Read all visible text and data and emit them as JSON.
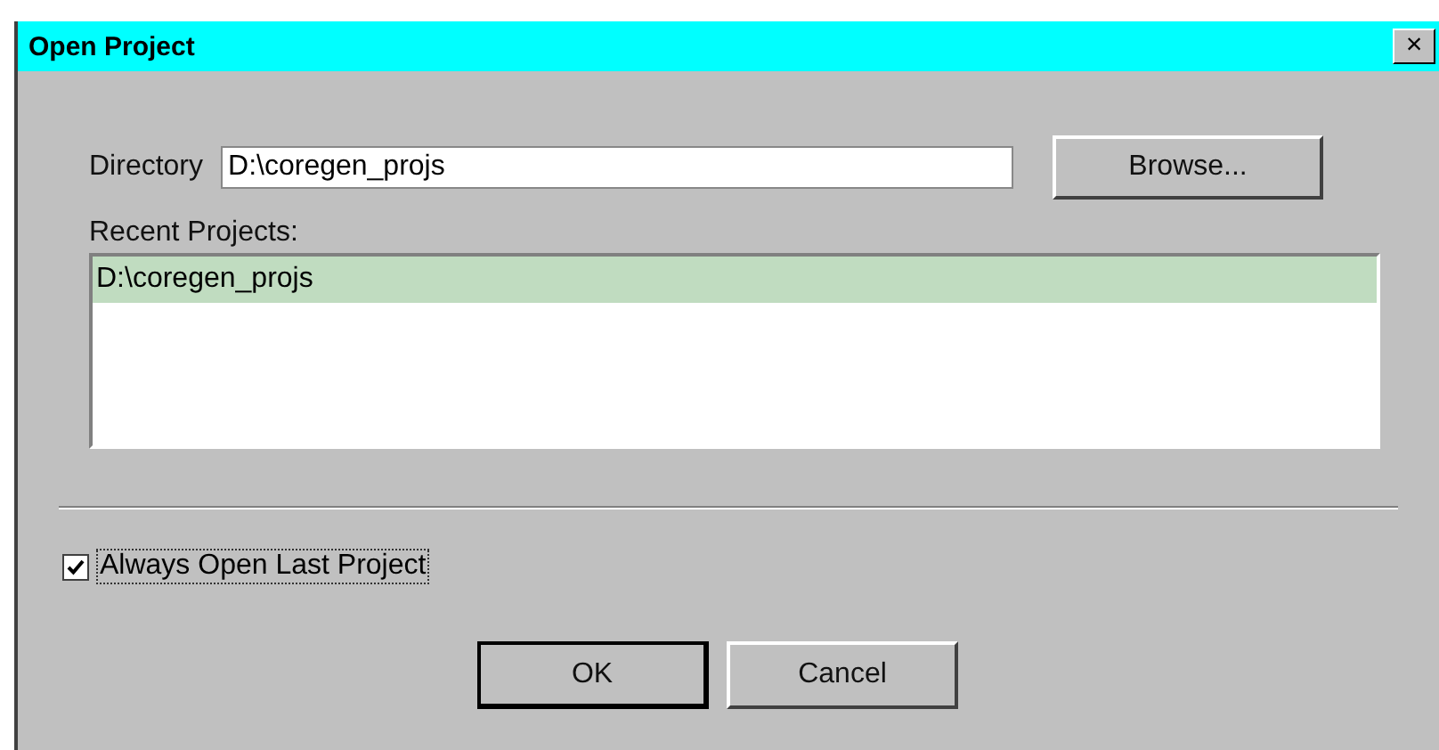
{
  "window": {
    "title": "Open Project",
    "close": "×"
  },
  "directory": {
    "label": "Directory",
    "value": "D:\\coregen_projs"
  },
  "browse_button": "Browse...",
  "recent": {
    "label": "Recent Projects:",
    "items": [
      {
        "text": "D:\\coregen_projs",
        "selected": true
      }
    ]
  },
  "always_open": {
    "label": "Always Open Last Project",
    "checked": true
  },
  "buttons": [
    {
      "label": "OK",
      "default": true
    },
    {
      "label": "Cancel",
      "default": false
    }
  ]
}
